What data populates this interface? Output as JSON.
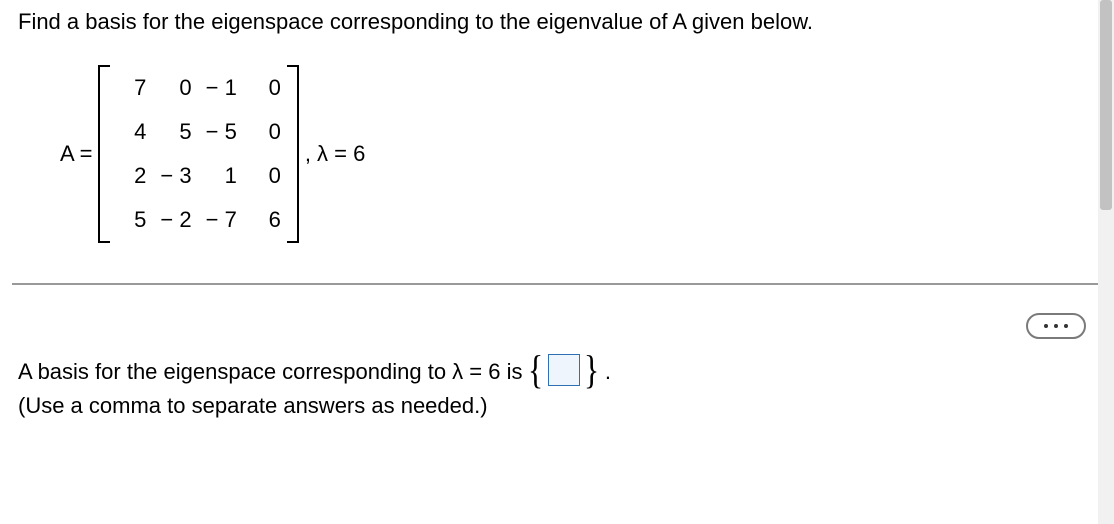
{
  "question": "Find a basis for the eigenspace corresponding to the eigenvalue of A given below.",
  "matrix_label": "A =",
  "matrix_rows": [
    [
      "7",
      "0",
      "− 1",
      "0"
    ],
    [
      "4",
      "5",
      "− 5",
      "0"
    ],
    [
      "2",
      "− 3",
      "1",
      "0"
    ],
    [
      "5",
      "− 2",
      "− 7",
      "6"
    ]
  ],
  "eigen_spec": ", λ = 6",
  "answer_prefix": "A basis for the eigenspace corresponding to λ = 6 is ",
  "answer_suffix": ".",
  "answer_instruction": "(Use a comma to separate answers as needed.)"
}
